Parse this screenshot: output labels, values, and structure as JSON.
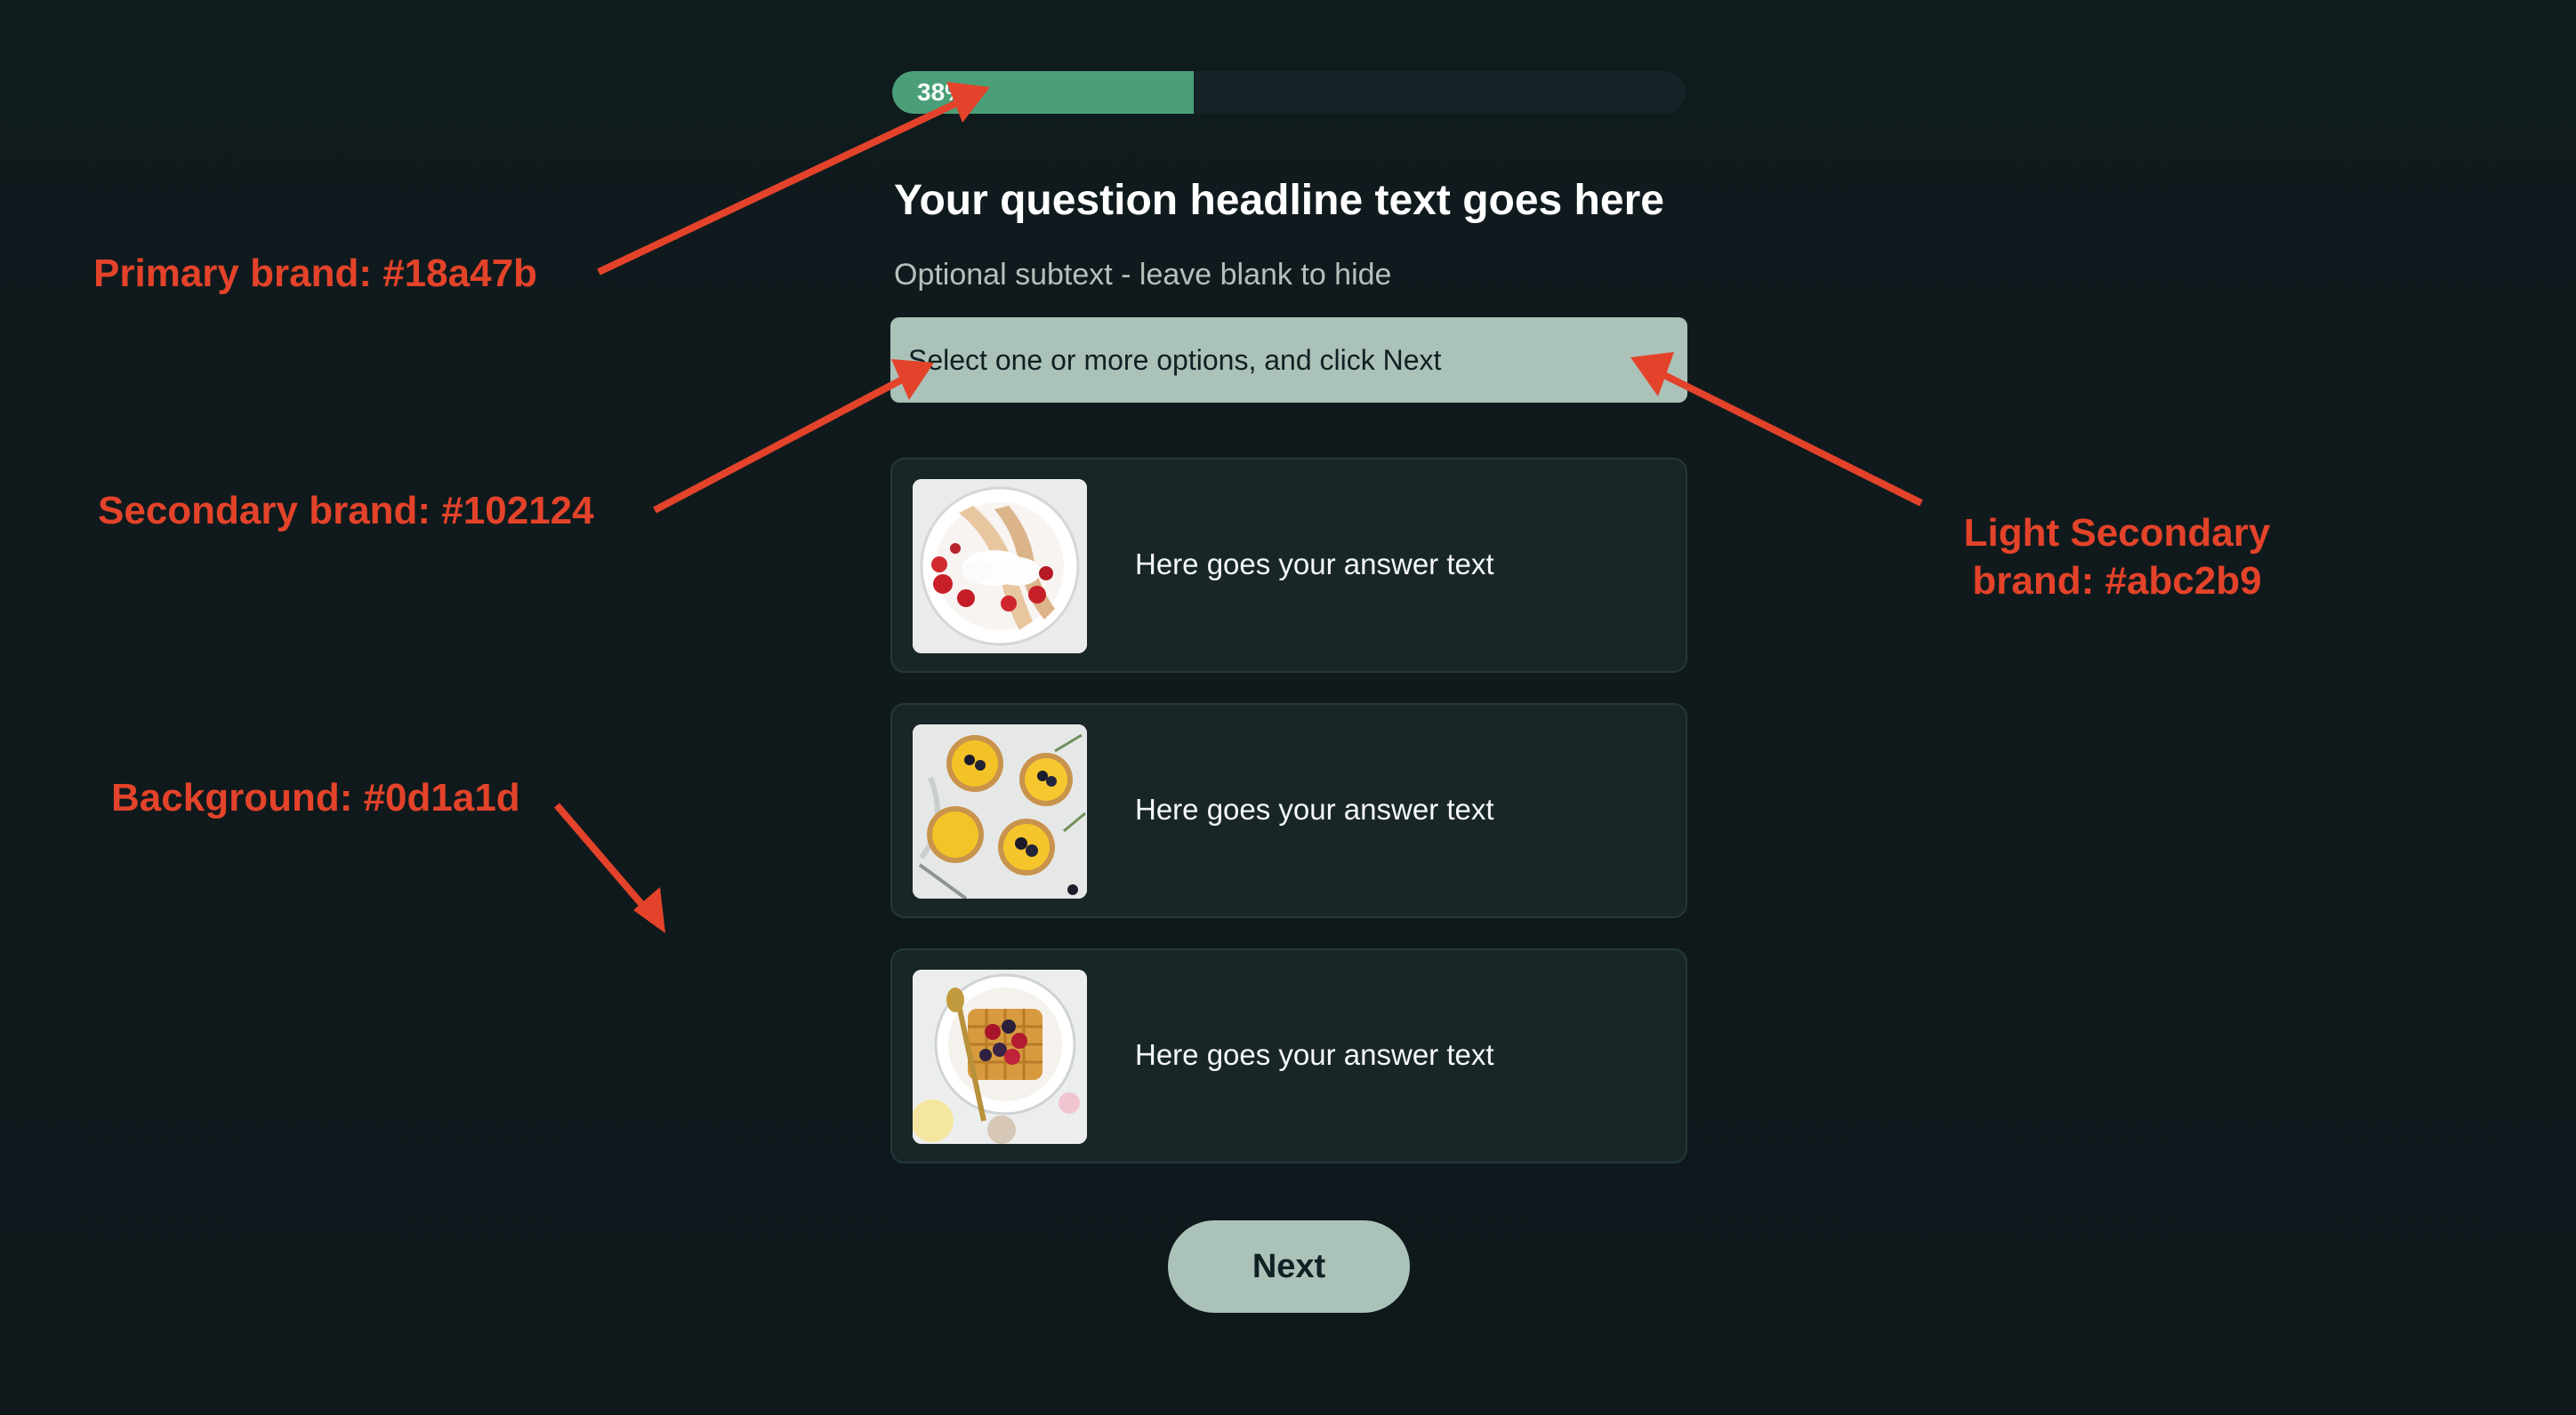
{
  "progress": {
    "value": 0.38,
    "label": "38%"
  },
  "question": {
    "headline": "Your question headline text goes here",
    "subtext": "Optional subtext - leave blank to hide",
    "instruction": "Select one or more options, and click Next"
  },
  "answers": [
    {
      "text": "Here goes your answer text",
      "image": "crepes-with-strawberries-and-cream"
    },
    {
      "text": "Here goes your answer text",
      "image": "citrus-tarts-with-blackberries"
    },
    {
      "text": "Here goes your answer text",
      "image": "waffle-with-berries"
    }
  ],
  "next_button": {
    "label": "Next"
  },
  "annotations": {
    "primary": "Primary brand: #18a47b",
    "secondary": "Secondary brand: #102124",
    "light_secondary_line1": "Light Secondary",
    "light_secondary_line2": "brand: #abc2b9",
    "background": "Background: #0d1a1d"
  },
  "colors": {
    "primary": "#18a47b",
    "secondary": "#102124",
    "light_secondary": "#abc2b9",
    "background": "#0d1a1d",
    "annotation": "#e3432a"
  }
}
